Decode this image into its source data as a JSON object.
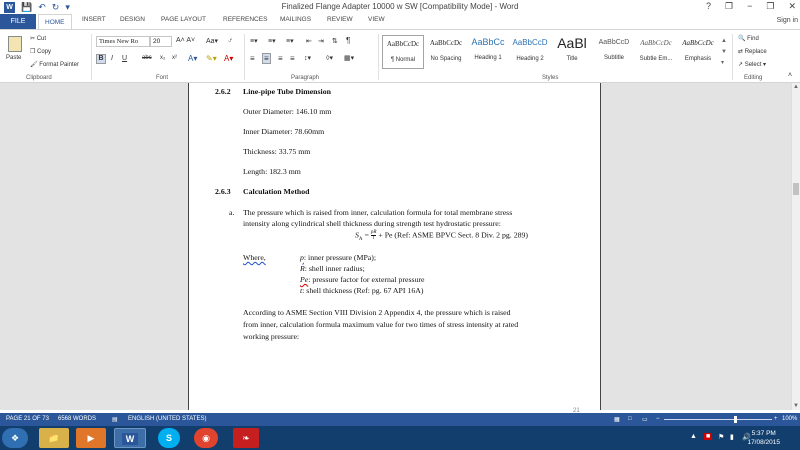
{
  "window": {
    "title": "Finalized Flange Adapter 10000 w SW [Compatibility Mode] - Word",
    "controls": [
      "?",
      "❐",
      "−",
      "❐",
      "✕"
    ]
  },
  "tabs": {
    "file": "FILE",
    "items": [
      "HOME",
      "INSERT",
      "DESIGN",
      "PAGE LAYOUT",
      "REFERENCES",
      "MAILINGS",
      "REVIEW",
      "VIEW"
    ],
    "active": "HOME",
    "sign_in": "Sign in"
  },
  "ribbon": {
    "clipboard": {
      "paste": "Paste",
      "cut": "Cut",
      "copy": "Copy",
      "format_painter": "Format Painter",
      "label": "Clipboard"
    },
    "font": {
      "family": "Times New Ro",
      "size": "20",
      "label": "Font",
      "bold": "B",
      "italic": "I",
      "underline": "U",
      "strike": "abc",
      "sub": "x₂",
      "sup": "x²"
    },
    "paragraph": {
      "label": "Paragraph"
    },
    "styles": {
      "label": "Styles",
      "items": [
        {
          "preview": "AaBbCcDc",
          "name": "¶ Normal"
        },
        {
          "preview": "AaBbCcDc",
          "name": "No Spacing"
        },
        {
          "preview": "AaBbCc",
          "name": "Heading 1"
        },
        {
          "preview": "AaBbCcD",
          "name": "Heading 2"
        },
        {
          "preview": "AaBl",
          "name": "Title"
        },
        {
          "preview": "AaBbCcD",
          "name": "Subtitle"
        },
        {
          "preview": "AaBbCcDc",
          "name": "Subtle Em..."
        },
        {
          "preview": "AaBbCcDc",
          "name": "Emphasis"
        }
      ]
    },
    "editing": {
      "find": "Find",
      "replace": "Replace",
      "select": "Select",
      "label": "Editing"
    }
  },
  "document": {
    "h1_num": "2.6.2",
    "h1_text": "Line-pipe Tube Dimension",
    "outer": "Outer Diameter: 146.10 mm",
    "inner": "Inner Diameter: 78.60mm",
    "thickness": "Thickness: 33.75 mm",
    "length": "Length: 182.3 mm",
    "h2_num": "2.6.3",
    "h2_text": "Calculation Method",
    "item_a": "a.",
    "para1_l1": "The pressure which is raised from inner, calculation formula for total membrane stress",
    "para1_l2": "intensity along cylindrical shell thickness during strength test hydrostatic pressure:",
    "formula_lhs": "S",
    "formula_sub": "A",
    "formula_eq": " = ",
    "formula_num": "pR",
    "formula_den": "t",
    "formula_rest": "+ Pe (Ref: ASME BPVC Sect. 8 Div. 2 pg. 289)",
    "where": "Where,",
    "w1_sym": "p",
    "w1_text": ": inner pressure (MPa);",
    "w2_sym": "R",
    "w2_text": ": shell inner radius;",
    "w3_sym": "Pe",
    "w3_text": ": pressure factor for external pressure",
    "w4_sym": "t",
    "w4_text": ": shell thickness   (Ref: pg. 67 API 16A)",
    "para2_l1": "According to ASME Section VIII Division 2 Appendix 4, the pressure which is raised",
    "para2_l2": "from inner, calculation formula maximum value for two times of stress intensity at rated",
    "para2_l3": "working pressure:",
    "page_number_fragment": "21"
  },
  "status": {
    "page": "PAGE 21 OF 73",
    "words": "6568 WORDS",
    "language": "ENGLISH (UNITED STATES)",
    "zoom": "100%"
  },
  "taskbar": {
    "time": "5:37 PM",
    "date": "17/08/2015",
    "apps": [
      "start",
      "explorer",
      "media-player",
      "word",
      "skype",
      "chrome",
      "acrobat"
    ]
  },
  "colors": {
    "accent": "#2b579a",
    "taskbar": "#123e6e",
    "page_bg": "#ffffff",
    "canvas_bg": "#e3e3e3"
  }
}
